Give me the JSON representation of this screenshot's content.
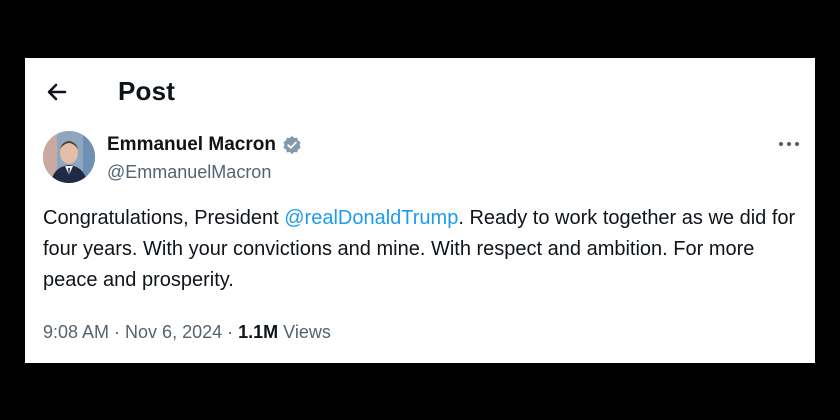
{
  "header": {
    "title": "Post"
  },
  "author": {
    "name": "Emmanuel Macron",
    "handle": "@EmmanuelMacron",
    "verified": true
  },
  "tweet": {
    "text_before": "Congratulations, President ",
    "mention": "@realDonaldTrump",
    "text_after": ". Ready to work together as we did for four years. With your convictions and mine. With respect and ambition. For more peace and prosperity."
  },
  "meta": {
    "time": "9:08 AM",
    "separator": "·",
    "date": "Nov 6, 2024",
    "views_count": "1.1M",
    "views_label": "Views"
  },
  "colors": {
    "link": "#1d9bf0",
    "secondary_text": "#536471",
    "primary_text": "#0f1419",
    "verified_badge": "#829aab",
    "background": "#ffffff",
    "frame": "#000000"
  },
  "icons": {
    "back": "arrow-left-icon",
    "verified": "verified-badge-icon",
    "more": "more-options-icon"
  }
}
